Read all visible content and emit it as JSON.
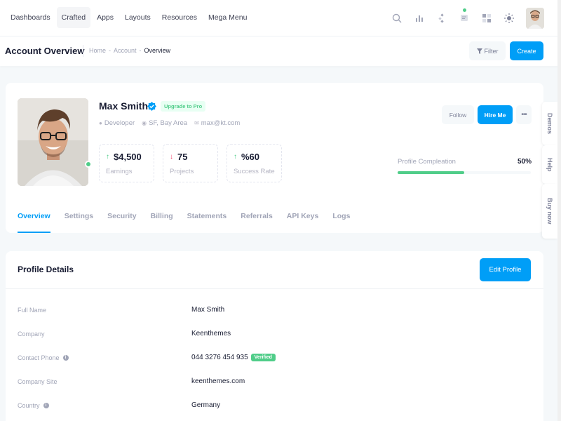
{
  "nav": {
    "items": [
      {
        "label": "Dashboards",
        "active": false
      },
      {
        "label": "Crafted",
        "active": true
      },
      {
        "label": "Apps",
        "active": false
      },
      {
        "label": "Layouts",
        "active": false
      },
      {
        "label": "Resources",
        "active": false
      },
      {
        "label": "Mega Menu",
        "active": false
      }
    ],
    "icons": [
      "search-icon",
      "chart-icon",
      "nodes-icon",
      "chat-icon",
      "grid-icon",
      "sun-icon"
    ]
  },
  "toolbar": {
    "title": "Account Overview",
    "breadcrumb": [
      "Home",
      "-",
      "Account",
      "-",
      "Overview"
    ],
    "filter_label": "Filter",
    "create_label": "Create"
  },
  "profile": {
    "name": "Max Smith",
    "badge": "Upgrade to Pro",
    "role": "Developer",
    "location": "SF, Bay Area",
    "email": "max@kt.com",
    "stats": [
      {
        "value": "$4,500",
        "label": "Earnings",
        "trend": "up"
      },
      {
        "value": "75",
        "label": "Projects",
        "trend": "down"
      },
      {
        "value": "%60",
        "label": "Success Rate",
        "trend": "up"
      }
    ],
    "follow_label": "Follow",
    "hire_label": "Hire Me",
    "more_label": "•••",
    "completion_label": "Profile Compleation",
    "completion_value": "50%",
    "completion_fraction": 0.5,
    "tabs": [
      "Overview",
      "Settings",
      "Security",
      "Billing",
      "Statements",
      "Referrals",
      "API Keys",
      "Logs"
    ]
  },
  "details": {
    "title": "Profile Details",
    "edit_label": "Edit Profile",
    "rows": [
      {
        "key": "Full Name",
        "value": "Max Smith",
        "info": false
      },
      {
        "key": "Company",
        "value": "Keenthemes",
        "info": false
      },
      {
        "key": "Contact Phone",
        "value": "044 3276 454 935",
        "info": true,
        "badge": "Verified"
      },
      {
        "key": "Company Site",
        "value": "keenthemes.com",
        "info": false
      },
      {
        "key": "Country",
        "value": "Germany",
        "info": true
      }
    ]
  },
  "side_tabs": [
    "Demos",
    "Help",
    "Buy now"
  ],
  "colors": {
    "primary": "#009ef7",
    "success": "#50cd89",
    "danger": "#f1416c"
  }
}
